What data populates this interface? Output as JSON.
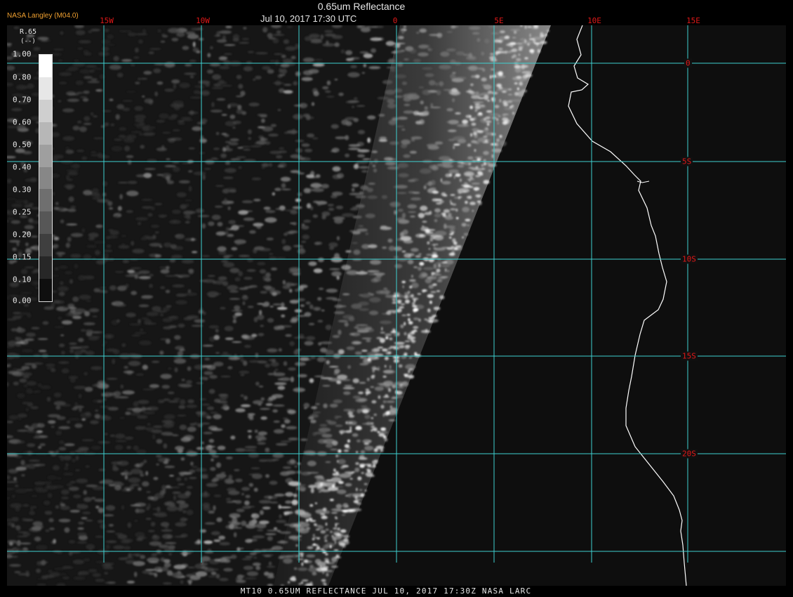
{
  "header": {
    "organization": "NASA Langley (M04.0)",
    "title": "0.65um Reflectance",
    "datetime": "Jul 10, 2017 17:30 UTC"
  },
  "legend": {
    "title": "R.65",
    "unit": "(--)",
    "ticks": [
      "1.00",
      "0.80",
      "0.70",
      "0.60",
      "0.50",
      "0.40",
      "0.30",
      "0.25",
      "0.20",
      "0.15",
      "0.10",
      "0.00"
    ]
  },
  "longitude_labels": [
    "15W",
    "10W",
    "0",
    "5E",
    "10E",
    "15E"
  ],
  "latitude_labels": [
    "0",
    "5S",
    "10S",
    "15S",
    "20S"
  ],
  "footer": {
    "text": "MT10  0.65UM REFLECTANCE   JUL 10, 2017 17:30Z   NASA LARC"
  },
  "colors": {
    "grid": "#3fd0d0",
    "coastline": "#ffffff",
    "label_red": "#e01818",
    "org_orange": "#f0a030"
  }
}
